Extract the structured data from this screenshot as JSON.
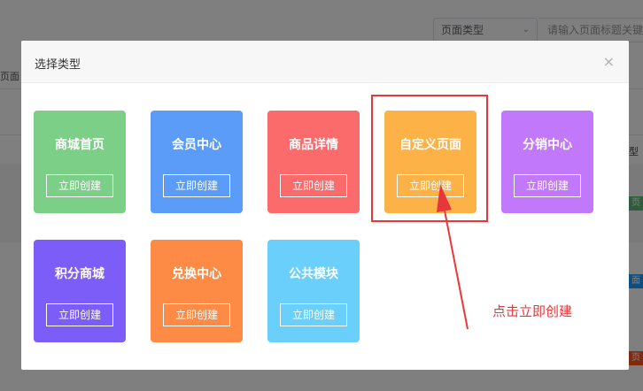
{
  "background": {
    "filter_select": "页面类型",
    "search_placeholder": "请输入页面标题关键",
    "left_tab": "页面",
    "right_text": "型",
    "badges": [
      "页",
      "面",
      "页"
    ]
  },
  "modal": {
    "title": "选择类型",
    "close_symbol": "×",
    "cards": [
      {
        "title": "商城首页",
        "button": "立即创建",
        "color": "#7ccf86"
      },
      {
        "title": "会员中心",
        "button": "立即创建",
        "color": "#5a9cf8"
      },
      {
        "title": "商品详情",
        "button": "立即创建",
        "color": "#fb6b6b"
      },
      {
        "title": "自定义页面",
        "button": "立即创建",
        "color": "#fdb248"
      },
      {
        "title": "分销中心",
        "button": "立即创建",
        "color": "#c278fb"
      },
      {
        "title": "积分商城",
        "button": "立即创建",
        "color": "#7d5df8"
      },
      {
        "title": "兑换中心",
        "button": "立即创建",
        "color": "#fd8b46"
      },
      {
        "title": "公共模块",
        "button": "立即创建",
        "color": "#6ad0fb"
      }
    ]
  },
  "annotation": {
    "text": "点击立即创建",
    "color": "#e8373b"
  }
}
